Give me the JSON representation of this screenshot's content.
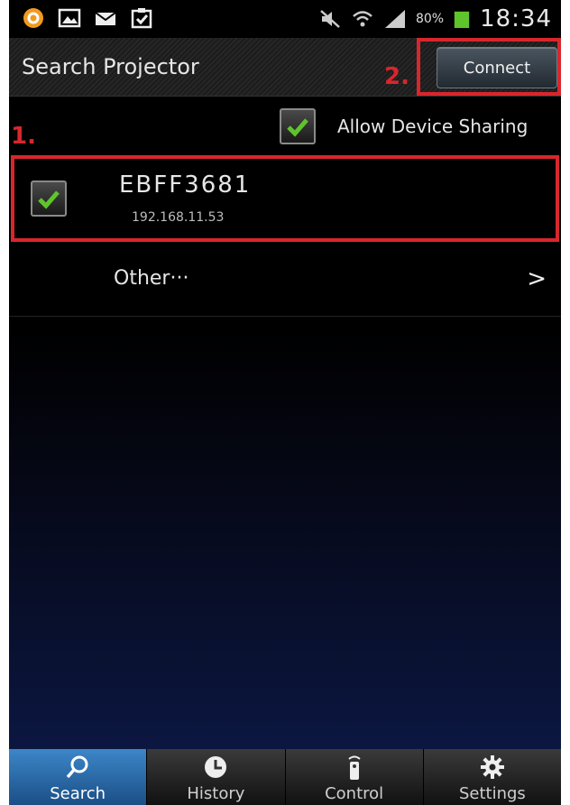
{
  "status_bar": {
    "battery_percent": "80%",
    "time": "18:34"
  },
  "header": {
    "title": "Search Projector",
    "connect_label": "Connect"
  },
  "annotations": {
    "first": "1.",
    "second": "2."
  },
  "sharing": {
    "label": "Allow Device Sharing",
    "checked": true
  },
  "device": {
    "name": "EBFF3681",
    "ip": "192.168.11.53",
    "checked": true
  },
  "other": {
    "label": "Other···",
    "chevron": ">"
  },
  "bottom_nav": {
    "items": [
      {
        "label": "Search",
        "icon": "search-icon",
        "active": true
      },
      {
        "label": "History",
        "icon": "history-icon",
        "active": false
      },
      {
        "label": "Control",
        "icon": "remote-control-icon",
        "active": false
      },
      {
        "label": "Settings",
        "icon": "gear-icon",
        "active": false
      }
    ]
  },
  "colors": {
    "annotation_red": "#d8262d",
    "check_green": "#5fc42c",
    "active_tab_blue": "#3c86c8"
  }
}
